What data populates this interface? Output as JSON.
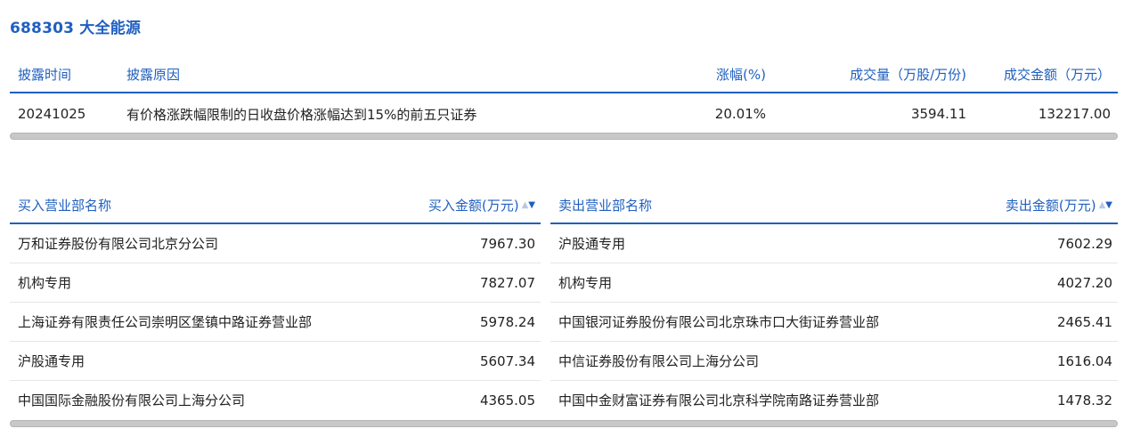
{
  "page": {
    "title": "688303 大全能源"
  },
  "summary_table": {
    "headers": [
      "披露时间",
      "披露原因",
      "涨幅(%)",
      "成交量（万股/万份)",
      "成交金额（万元）"
    ],
    "row": [
      "20241025",
      "有价格涨跌幅限制的日收盘价格涨幅达到15%的前五只证券",
      "20.01%",
      "3594.11",
      "132217.00"
    ]
  },
  "buy_table": {
    "name_header": "买入营业部名称",
    "amount_header": "买入金额(万元)",
    "rows": [
      {
        "name": "万和证券股份有限公司北京分公司",
        "amount": "7967.30"
      },
      {
        "name": "机构专用",
        "amount": "7827.07"
      },
      {
        "name": "上海证券有限责任公司崇明区堡镇中路证券营业部",
        "amount": "5978.24"
      },
      {
        "name": "沪股通专用",
        "amount": "5607.34"
      },
      {
        "name": "中国国际金融股份有限公司上海分公司",
        "amount": "4365.05"
      }
    ]
  },
  "sell_table": {
    "name_header": "卖出营业部名称",
    "amount_header": "卖出金额(万元)",
    "rows": [
      {
        "name": "沪股通专用",
        "amount": "7602.29"
      },
      {
        "name": "机构专用",
        "amount": "4027.20"
      },
      {
        "name": "中国银河证券股份有限公司北京珠市口大街证券营业部",
        "amount": "2465.41"
      },
      {
        "name": "中信证券股份有限公司上海分公司",
        "amount": "1616.04"
      },
      {
        "name": "中国中金财富证券有限公司北京科学院南路证券营业部",
        "amount": "1478.32"
      }
    ]
  },
  "icons": {
    "sort_up": "▲",
    "sort_down": "▼"
  },
  "colors": {
    "accent": "#1f5fbf",
    "text": "#222222",
    "scrollbar": "#c8c8c8"
  }
}
